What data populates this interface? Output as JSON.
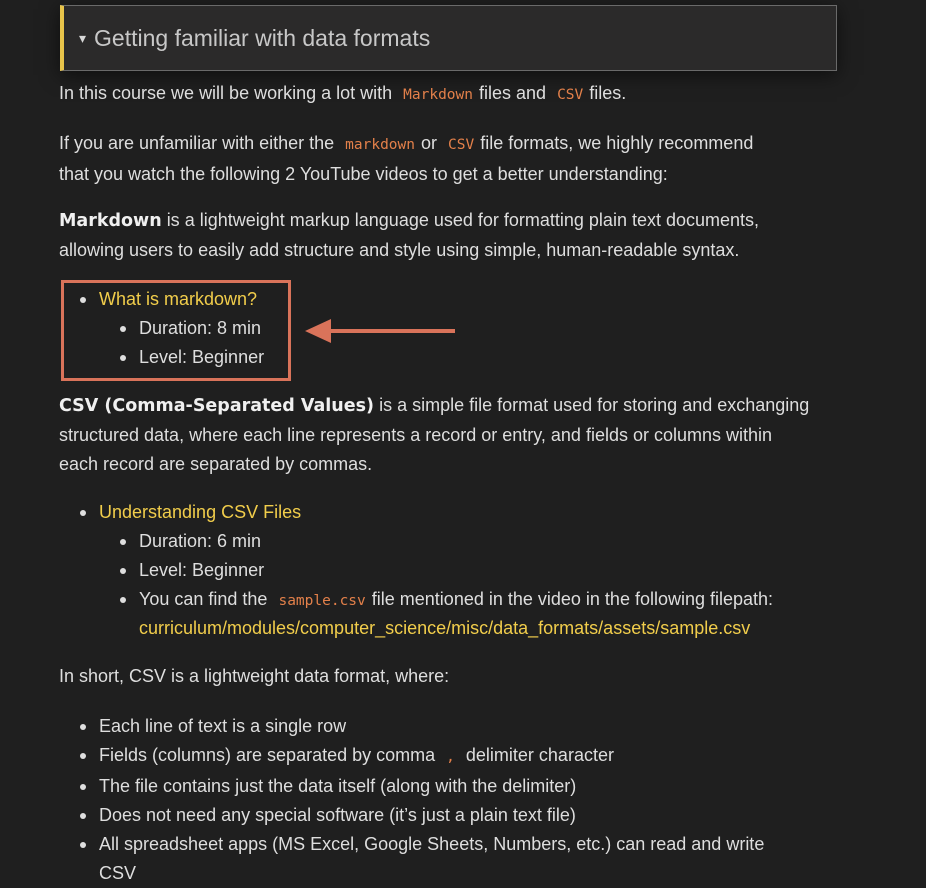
{
  "details": {
    "caret": "▾",
    "title": "Getting familiar with data formats"
  },
  "intro": {
    "pre": "In this course we will be working a lot with",
    "code1": "Markdown",
    "mid": "files and",
    "code2": "CSV",
    "post": "files."
  },
  "recommend": {
    "pre": "If you are unfamiliar with either the",
    "code1": "markdown",
    "mid": "or",
    "code2": "CSV",
    "post": "file formats, we highly recommend",
    "line2": "that you watch the following 2 YouTube videos to get a better understanding:"
  },
  "markdown_desc": {
    "bold": "Markdown",
    "line1": "is a lightweight markup language used for formatting plain text documents,",
    "line2": "allowing users to easily add structure and style using simple, human-readable syntax."
  },
  "markdown_video": {
    "title": "What is markdown?",
    "duration": "Duration: 8 min",
    "level": "Level: Beginner"
  },
  "csv_desc": {
    "bold": "CSV (Comma-Separated Values)",
    "line1": "is a simple file format used for storing and exchanging",
    "line2": "structured data, where each line represents a record or entry, and fields or columns within",
    "line3": "each record are separated by commas."
  },
  "csv_video": {
    "title": "Understanding CSV Files",
    "duration": "Duration: 6 min",
    "level": "Level: Beginner",
    "find_pre": "You can find the",
    "find_code": "sample.csv",
    "find_post": "file mentioned in the video in the following filepath:",
    "path": "curriculum/modules/computer_science/misc/data_formats/assets/sample.csv"
  },
  "in_short": "In short, CSV is a lightweight data format, where:",
  "csv_points": {
    "p1": "Each line of text is a single row",
    "p2_pre": "Fields (columns) are separated by comma",
    "p2_code": ",",
    "p2_post": "delimiter character",
    "p3": "The file contains just the data itself (along with the delimiter)",
    "p4": "Does not need any special software (it’s just a plain text file)",
    "p5_line1": "All spreadsheet apps (MS Excel, Google Sheets, Numbers, etc.) can read and write",
    "p5_line2": "CSV"
  },
  "colors": {
    "background": "#1f1f1f",
    "link": "#f1cd4b",
    "code": "#e3804a",
    "annotation": "#d9735a",
    "summary_accent": "#e8c44a"
  }
}
